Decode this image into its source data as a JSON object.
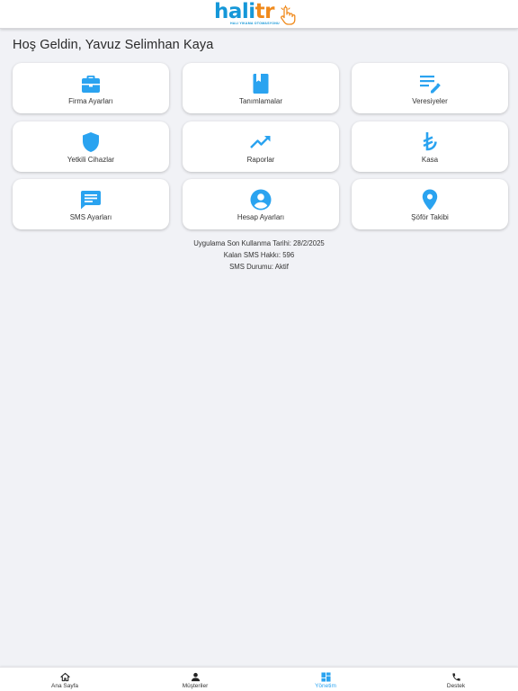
{
  "header": {
    "logo_part1": "hali",
    "logo_part2": "tr",
    "logo_tagline": "HALI YIKAMA OTOMASYONU"
  },
  "greeting": "Hoş Geldin, Yavuz Selimhan Kaya",
  "accent_color": "#2aa3f0",
  "tiles": [
    {
      "label": "Firma Ayarları",
      "icon": "briefcase-icon"
    },
    {
      "label": "Tanımlamalar",
      "icon": "book-icon"
    },
    {
      "label": "Veresiyeler",
      "icon": "edit-list-icon"
    },
    {
      "label": "Yetkili Cihazlar",
      "icon": "shield-icon"
    },
    {
      "label": "Raporlar",
      "icon": "trending-up-icon"
    },
    {
      "label": "Kasa",
      "icon": "lira-icon"
    },
    {
      "label": "SMS Ayarları",
      "icon": "message-icon"
    },
    {
      "label": "Hesap Ayarları",
      "icon": "account-circle-icon"
    },
    {
      "label": "Şöför Takibi",
      "icon": "location-pin-icon"
    }
  ],
  "info": {
    "last_use": "Uygulama Son Kullanma Tarihi: 28/2/2025",
    "sms_left": "Kalan SMS Hakkı: 596",
    "sms_status": "SMS Durumu: Aktif"
  },
  "bottom_nav": [
    {
      "label": "Ana Sayfa",
      "icon": "home-icon",
      "active": false
    },
    {
      "label": "Müşteriler",
      "icon": "person-icon",
      "active": false
    },
    {
      "label": "Yönetim",
      "icon": "dashboard-icon",
      "active": true
    },
    {
      "label": "Destek",
      "icon": "phone-icon",
      "active": false
    }
  ]
}
